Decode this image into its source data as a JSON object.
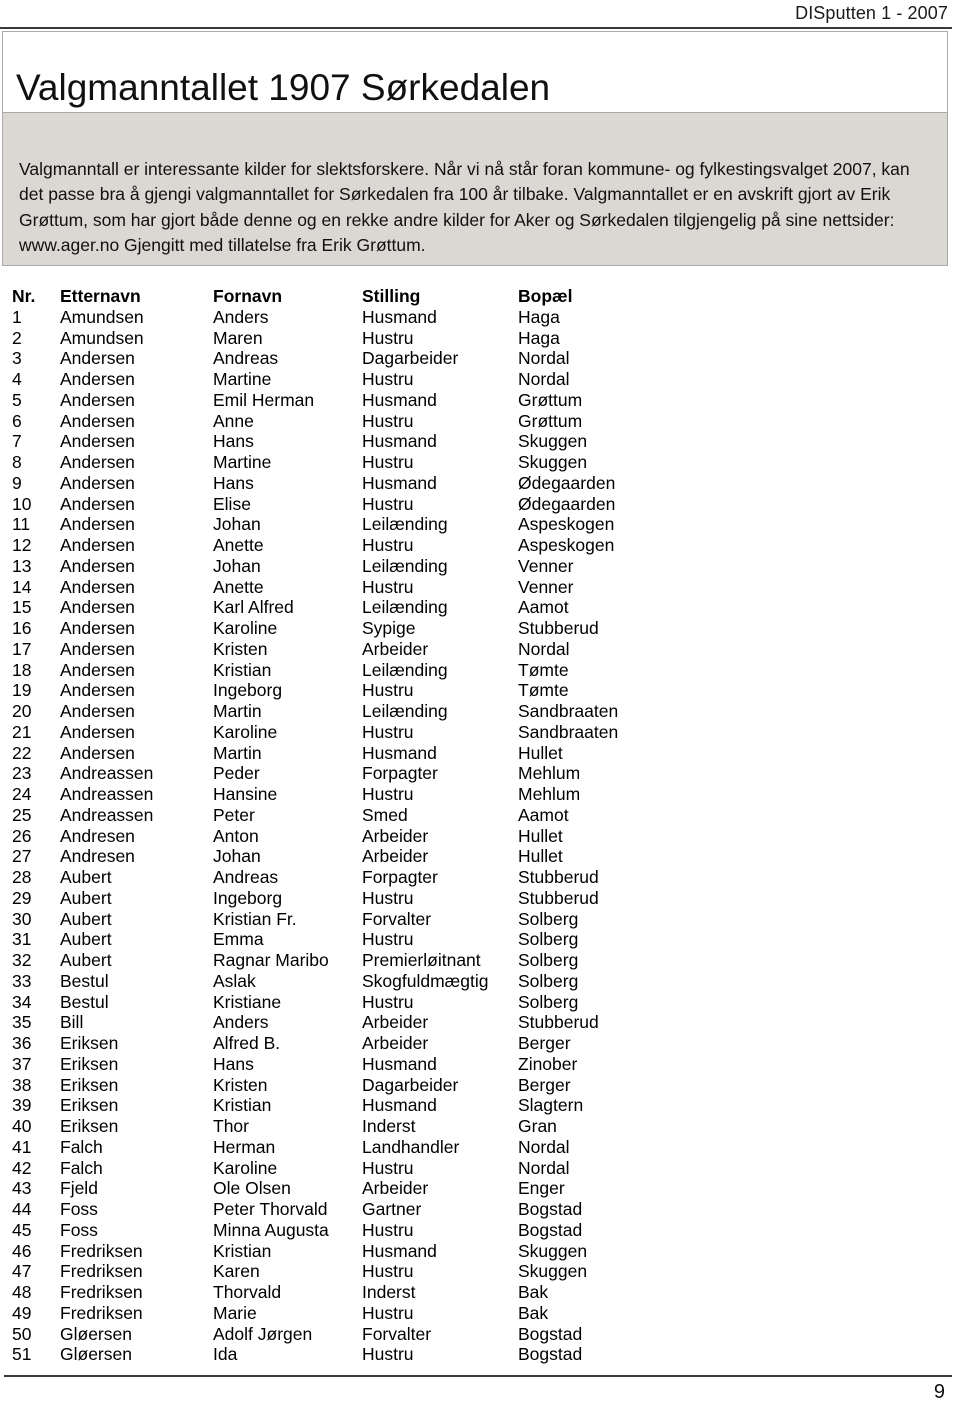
{
  "running_head": "DISputten 1 - 2007",
  "title": "Valgmanntallet 1907 Sørkedalen",
  "intro_paragraph": "Valgmanntall er interessante kilder for slektsforskere. Når vi nå står foran kommune- og fylkestingsvalget 2007, kan det passe bra å gjengi valgmanntallet for Sørkedalen fra 100 år tilbake. Valgmanntallet er en avskrift gjort av Erik Grøttum, som har gjort både denne og en rekke andre kilder for Aker og Sørkedalen tilgjengelig på sine nettsider: www.ager.no Gjengitt med tillatelse fra Erik Grøttum.",
  "page_number": "9",
  "colors": {
    "intro_panel_background": "#dbd7d3",
    "panel_border": "#a9a9a9",
    "rule": "#3a3a3a",
    "text": "#111111",
    "page_background": "#ffffff"
  },
  "table": {
    "columns": [
      "Nr.",
      "Etternavn",
      "Fornavn",
      "Stilling",
      "Bopæl"
    ],
    "rows": [
      [
        "1",
        "Amundsen",
        "Anders",
        "Husmand",
        "Haga"
      ],
      [
        "2",
        "Amundsen",
        "Maren",
        "Hustru",
        "Haga"
      ],
      [
        "3",
        "Andersen",
        "Andreas",
        "Dagarbeider",
        "Nordal"
      ],
      [
        "4",
        "Andersen",
        "Martine",
        "Hustru",
        "Nordal"
      ],
      [
        "5",
        "Andersen",
        "Emil Herman",
        "Husmand",
        "Grøttum"
      ],
      [
        "6",
        "Andersen",
        "Anne",
        "Hustru",
        "Grøttum"
      ],
      [
        "7",
        "Andersen",
        "Hans",
        "Husmand",
        "Skuggen"
      ],
      [
        "8",
        "Andersen",
        "Martine",
        "Hustru",
        "Skuggen"
      ],
      [
        "9",
        "Andersen",
        "Hans",
        "Husmand",
        "Ødegaarden"
      ],
      [
        "10",
        "Andersen",
        "Elise",
        "Hustru",
        "Ødegaarden"
      ],
      [
        "11",
        "Andersen",
        "Johan",
        "Leilænding",
        "Aspeskogen"
      ],
      [
        "12",
        "Andersen",
        "Anette",
        "Hustru",
        "Aspeskogen"
      ],
      [
        "13",
        "Andersen",
        "Johan",
        "Leilænding",
        "Venner"
      ],
      [
        "14",
        "Andersen",
        "Anette",
        "Hustru",
        "Venner"
      ],
      [
        "15",
        "Andersen",
        "Karl Alfred",
        "Leilænding",
        "Aamot"
      ],
      [
        "16",
        "Andersen",
        "Karoline",
        "Sypige",
        "Stubberud"
      ],
      [
        "17",
        "Andersen",
        "Kristen",
        "Arbeider",
        "Nordal"
      ],
      [
        "18",
        "Andersen",
        "Kristian",
        "Leilænding",
        "Tømte"
      ],
      [
        "19",
        "Andersen",
        "Ingeborg",
        "Hustru",
        "Tømte"
      ],
      [
        "20",
        "Andersen",
        "Martin",
        "Leilænding",
        "Sandbraaten"
      ],
      [
        "21",
        "Andersen",
        "Karoline",
        "Hustru",
        "Sandbraaten"
      ],
      [
        "22",
        "Andersen",
        "Martin",
        "Husmand",
        "Hullet"
      ],
      [
        "23",
        "Andreassen",
        "Peder",
        "Forpagter",
        "Mehlum"
      ],
      [
        "24",
        "Andreassen",
        "Hansine",
        "Hustru",
        "Mehlum"
      ],
      [
        "25",
        "Andreassen",
        "Peter",
        "Smed",
        "Aamot"
      ],
      [
        "26",
        "Andresen",
        "Anton",
        "Arbeider",
        "Hullet"
      ],
      [
        "27",
        "Andresen",
        "Johan",
        "Arbeider",
        "Hullet"
      ],
      [
        "28",
        "Aubert",
        "Andreas",
        "Forpagter",
        "Stubberud"
      ],
      [
        "29",
        "Aubert",
        "Ingeborg",
        "Hustru",
        "Stubberud"
      ],
      [
        "30",
        "Aubert",
        "Kristian Fr.",
        "Forvalter",
        "Solberg"
      ],
      [
        "31",
        "Aubert",
        "Emma",
        "Hustru",
        "Solberg"
      ],
      [
        "32",
        "Aubert",
        "Ragnar Maribo",
        "Premierløitnant",
        "Solberg"
      ],
      [
        "33",
        "Bestul",
        "Aslak",
        "Skogfuldmægtig",
        "Solberg"
      ],
      [
        "34",
        "Bestul",
        "Kristiane",
        "Hustru",
        "Solberg"
      ],
      [
        "35",
        "Bill",
        "Anders",
        "Arbeider",
        "Stubberud"
      ],
      [
        "36",
        "Eriksen",
        "Alfred B.",
        "Arbeider",
        "Berger"
      ],
      [
        "37",
        "Eriksen",
        "Hans",
        "Husmand",
        "Zinober"
      ],
      [
        "38",
        "Eriksen",
        "Kristen",
        "Dagarbeider",
        "Berger"
      ],
      [
        "39",
        "Eriksen",
        "Kristian",
        "Husmand",
        "Slagtern"
      ],
      [
        "40",
        "Eriksen",
        "Thor",
        "Inderst",
        "Gran"
      ],
      [
        "41",
        "Falch",
        "Herman",
        "Landhandler",
        "Nordal"
      ],
      [
        "42",
        "Falch",
        "Karoline",
        "Hustru",
        "Nordal"
      ],
      [
        "43",
        "Fjeld",
        "Ole Olsen",
        "Arbeider",
        "Enger"
      ],
      [
        "44",
        "Foss",
        "Peter Thorvald",
        "Gartner",
        "Bogstad"
      ],
      [
        "45",
        "Foss",
        "Minna Augusta",
        "Hustru",
        "Bogstad"
      ],
      [
        "46",
        "Fredriksen",
        "Kristian",
        "Husmand",
        "Skuggen"
      ],
      [
        "47",
        "Fredriksen",
        "Karen",
        "Hustru",
        "Skuggen"
      ],
      [
        "48",
        "Fredriksen",
        "Thorvald",
        "Inderst",
        "Bak"
      ],
      [
        "49",
        "Fredriksen",
        "Marie",
        "Hustru",
        "Bak"
      ],
      [
        "50",
        "Gløersen",
        "Adolf Jørgen",
        "Forvalter",
        "Bogstad"
      ],
      [
        "51",
        "Gløersen",
        "Ida",
        "Hustru",
        "Bogstad"
      ]
    ]
  }
}
